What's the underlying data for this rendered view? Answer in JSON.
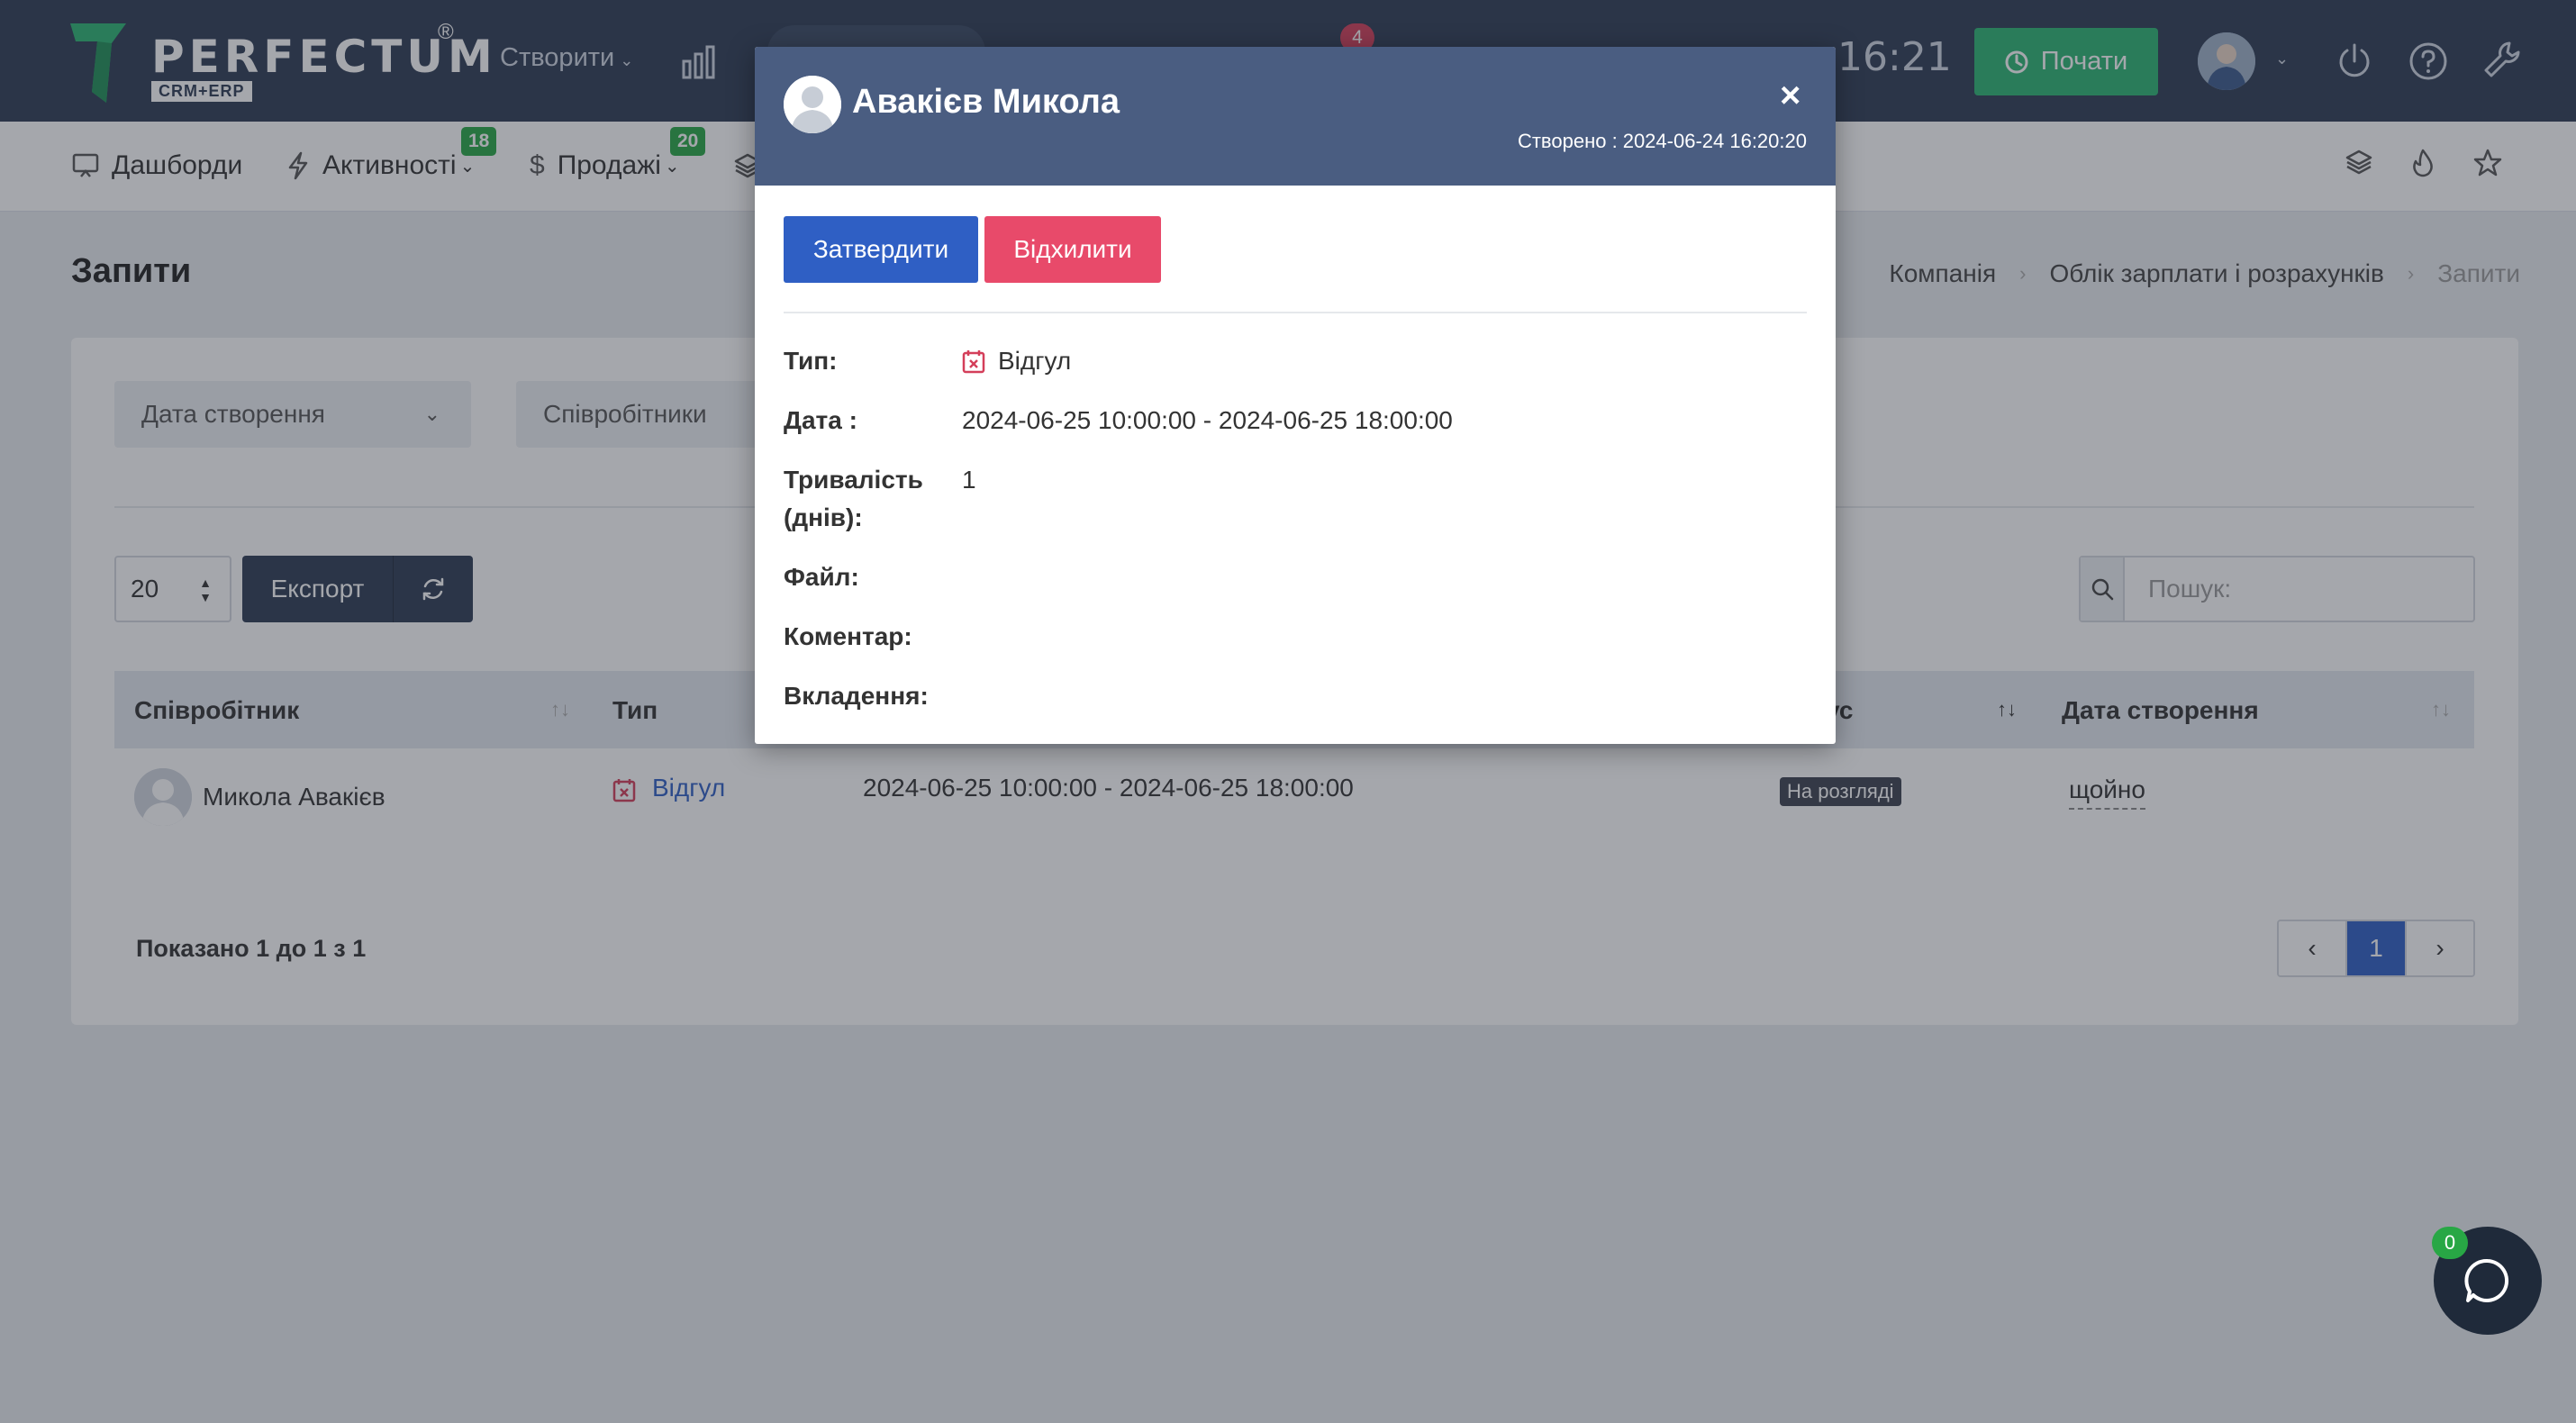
{
  "topbar": {
    "logo_text": "PERFECTUM",
    "logo_sub": "CRM+ERP",
    "logo_reg": "®",
    "create_label": "Створити",
    "notifications_count": "4",
    "clock": "16:21",
    "start_label": "Почати"
  },
  "navbar": {
    "items": [
      {
        "label": "Дашборди"
      },
      {
        "label": "Активності",
        "badge": "18"
      },
      {
        "label": "Продажі",
        "badge": "20"
      }
    ]
  },
  "page": {
    "title": "Запити",
    "breadcrumb": [
      "Компанія",
      "Облік зарплати і розрахунків",
      "Запити"
    ]
  },
  "filters": {
    "date_created": "Дата створення",
    "employees": "Співробітники"
  },
  "toolbar": {
    "per_page": "20",
    "export_label": "Експорт",
    "search_placeholder": "Пошук:"
  },
  "table": {
    "columns": {
      "employee": "Співробітник",
      "type": "Тип",
      "status_partial": "ус",
      "created": "Дата створення"
    },
    "rows": [
      {
        "employee": "Микола Авакієв",
        "type": "Відгул",
        "dates": "2024-06-25 10:00:00 - 2024-06-25 18:00:00",
        "status": "На розгляді",
        "created": "щойно"
      }
    ],
    "showing": "Показано 1 до 1 з 1",
    "page": "1"
  },
  "modal": {
    "title": "Авакієв Микола",
    "close": "×",
    "created_label": "Створено :",
    "created_value": "2024-06-24 16:20:20",
    "approve_label": "Затвердити",
    "reject_label": "Відхилити",
    "fields": {
      "type_label": "Тип:",
      "type_value": "Відгул",
      "date_label": "Дата :",
      "date_value": "2024-06-25 10:00:00 - 2024-06-25 18:00:00",
      "duration_label": "Тривалість (днів):",
      "duration_value": "1",
      "file_label": "Файл:",
      "comment_label": "Коментар:",
      "attachments_label": "Вкладення:"
    }
  },
  "chat": {
    "badge": "0"
  },
  "colors": {
    "topbar": "#2e3c54",
    "modal_header": "#4a5d81",
    "approve": "#2f5fc4",
    "reject": "#e84a6a",
    "start": "#2bb673",
    "badge_green": "#28a745",
    "badge_red": "#d43f5a"
  },
  "icons": [
    "logo-mark",
    "chart-bar-icon",
    "power-icon",
    "help-icon",
    "wrench-icon",
    "dashboard-icon",
    "bolt-icon",
    "dollar-icon",
    "layers-icon",
    "fire-icon",
    "star-icon",
    "search-icon",
    "refresh-icon",
    "calendar-x-icon",
    "clock-icon",
    "chat-icon"
  ]
}
